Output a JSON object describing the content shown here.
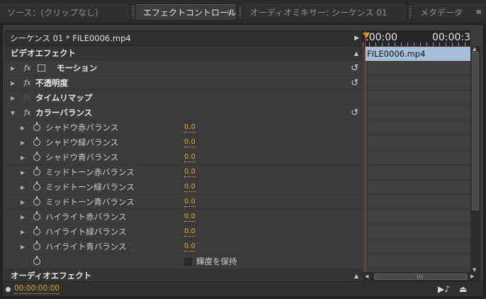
{
  "tabs": [
    {
      "label": "ソース：(クリップなし)",
      "active": false
    },
    {
      "label": "エフェクトコントロール",
      "active": true,
      "close": "×"
    },
    {
      "label": "オーディオミキサー: シーケンス 01",
      "active": false
    },
    {
      "label": "メタデータ",
      "active": false
    }
  ],
  "panel_menu_icon": "≡",
  "sequence_header": "シーケンス 01 * FILE0006.mp4",
  "video_effects_label": "ビデオエフェクト",
  "audio_effects_label": "オーディオエフェクト",
  "fx_label": "fx",
  "effects": {
    "motion": "モーション",
    "opacity": "不透明度",
    "time_remap": "タイムリマップ",
    "color_balance": "カラーバランス"
  },
  "params": [
    {
      "name": "シャドウ赤バランス",
      "value": "0.0"
    },
    {
      "name": "シャドウ緑バランス",
      "value": "0.0"
    },
    {
      "name": "シャドウ青バランス",
      "value": "0.0"
    },
    {
      "name": "ミッドトーン赤バランス",
      "value": "0.0"
    },
    {
      "name": "ミッドトーン緑バランス",
      "value": "0.0"
    },
    {
      "name": "ミッドトーン青バランス",
      "value": "0.0"
    },
    {
      "name": "ハイライト赤バランス",
      "value": "0.0"
    },
    {
      "name": "ハイライト緑バランス",
      "value": "0.0"
    },
    {
      "name": "ハイライト青バランス",
      "value": "0.0"
    }
  ],
  "preserve_luminosity": {
    "label": "輝度を保持",
    "checked": false
  },
  "timeline": {
    "start_time": ":00:00",
    "end_time": "00:00:3",
    "clip_name": "FILE0006.mp4"
  },
  "current_time": "00:00:00:00",
  "colors": {
    "value_orange": "#e0a92e",
    "clip_blue": "#a8bfdc",
    "playhead_red": "#c53a3a",
    "panel_bg": "#3b3b3b"
  }
}
